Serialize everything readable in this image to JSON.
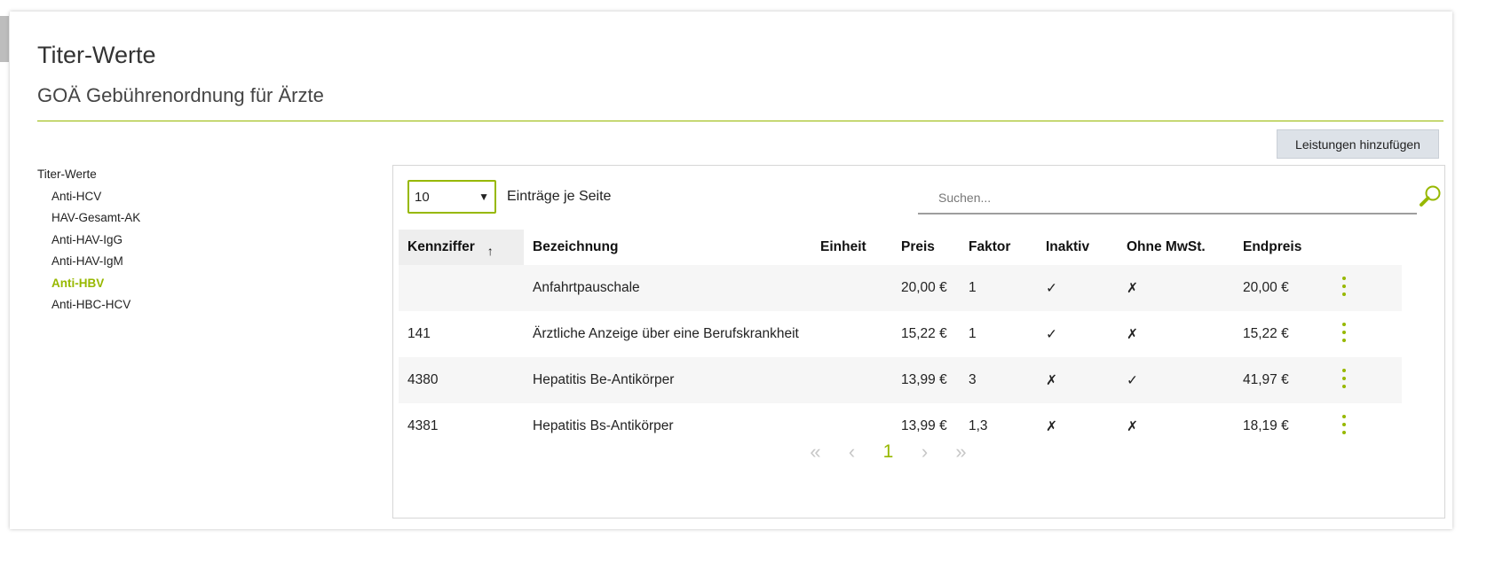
{
  "page": {
    "title": "Titer-Werte",
    "subtitle": "GOÄ Gebührenordnung für Ärzte",
    "add_button_label": "Leistungen hinzufügen"
  },
  "tree": {
    "root": "Titer-Werte",
    "items": [
      {
        "label": "Anti-HCV",
        "active": false
      },
      {
        "label": "HAV-Gesamt-AK",
        "active": false
      },
      {
        "label": "Anti-HAV-IgG",
        "active": false
      },
      {
        "label": "Anti-HAV-IgM",
        "active": false
      },
      {
        "label": "Anti-HBV",
        "active": true
      },
      {
        "label": "Anti-HBC-HCV",
        "active": false
      }
    ]
  },
  "controls": {
    "page_length_value": "10",
    "page_length_label": "Einträge je Seite",
    "search_placeholder": "Suchen...",
    "search_value": ""
  },
  "table": {
    "columns": [
      "Kennziffer",
      "Bezeichnung",
      "Einheit",
      "Preis",
      "Faktor",
      "Inaktiv",
      "Ohne MwSt.",
      "Endpreis"
    ],
    "sorted_column": "Kennziffer",
    "sort_indicator": "↑",
    "rows": [
      {
        "kennziffer": "",
        "bezeichnung": "Anfahrtpauschale",
        "einheit": "",
        "preis": "20,00 €",
        "faktor": "1",
        "inaktiv": "✓",
        "ohne_mwst": "✗",
        "endpreis": "20,00 €"
      },
      {
        "kennziffer": "141",
        "bezeichnung": "Ärztliche Anzeige über eine Berufskrankheit",
        "einheit": "",
        "preis": "15,22 €",
        "faktor": "1",
        "inaktiv": "✓",
        "ohne_mwst": "✗",
        "endpreis": "15,22 €"
      },
      {
        "kennziffer": "4380",
        "bezeichnung": "Hepatitis Be-Antikörper",
        "einheit": "",
        "preis": "13,99 €",
        "faktor": "3",
        "inaktiv": "✗",
        "ohne_mwst": "✓",
        "endpreis": "41,97 €"
      },
      {
        "kennziffer": "4381",
        "bezeichnung": "Hepatitis Bs-Antikörper",
        "einheit": "",
        "preis": "13,99 €",
        "faktor": "1,3",
        "inaktiv": "✗",
        "ohne_mwst": "✗",
        "endpreis": "18,19 €"
      }
    ]
  },
  "pagination": {
    "first": "«",
    "prev": "‹",
    "current": "1",
    "next": "›",
    "last": "»"
  },
  "icons": {
    "search": "search-icon",
    "row_menu": "kebab-menu-icon",
    "select_arrow": "chevron-down-icon"
  },
  "colors": {
    "accent": "#97b800",
    "button_bg": "#dde2e8",
    "row_alt": "#f6f6f6",
    "disabled": "#c7c7c7"
  }
}
